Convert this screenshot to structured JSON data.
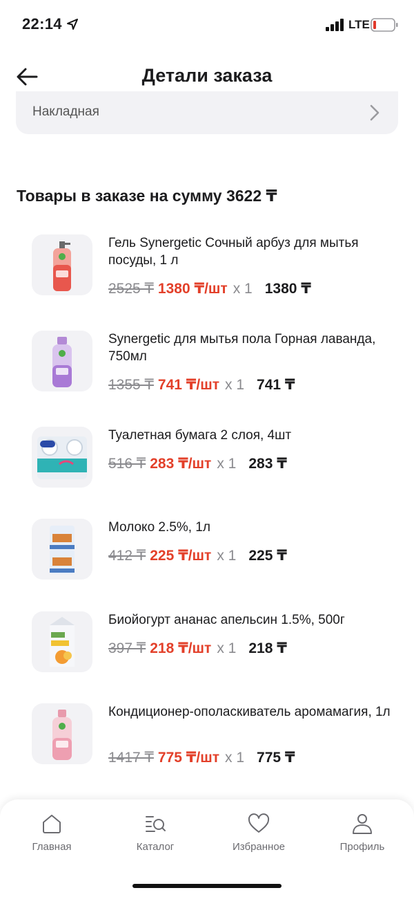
{
  "status_bar": {
    "time": "22:14",
    "network": "LTE"
  },
  "header": {
    "title": "Детали заказа"
  },
  "invoice": {
    "label": "Накладная"
  },
  "section": {
    "title": "Товары в заказе на сумму 3622 ₸"
  },
  "products": [
    {
      "name": "Гель Synergetic Сочный арбуз для мытья посуды, 1 л",
      "old_price": "2525 ₸",
      "unit_price": "1380 ₸/шт",
      "qty": "x 1",
      "total": "1380 ₸"
    },
    {
      "name": "Synergetic для мытья пола Горная лаванда, 750мл",
      "old_price": "1355 ₸",
      "unit_price": "741 ₸/шт",
      "qty": "x 1",
      "total": "741 ₸"
    },
    {
      "name": "Туалетная бумага 2 слоя, 4шт",
      "old_price": "516 ₸",
      "unit_price": "283 ₸/шт",
      "qty": "x 1",
      "total": "283 ₸"
    },
    {
      "name": "Молоко 2.5%, 1л",
      "old_price": "412 ₸",
      "unit_price": "225 ₸/шт",
      "qty": "x 1",
      "total": "225 ₸"
    },
    {
      "name": "Биойогурт ананас апельсин 1.5%, 500г",
      "old_price": "397 ₸",
      "unit_price": "218 ₸/шт",
      "qty": "x 1",
      "total": "218 ₸"
    },
    {
      "name": "Кондиционер-ополаскиватель аромамагия, 1л",
      "old_price": "1417 ₸",
      "unit_price": "775 ₸/шт",
      "qty": "x 1",
      "total": "775 ₸"
    }
  ],
  "tab_bar": {
    "home": "Главная",
    "catalog": "Каталог",
    "favorites": "Избранное",
    "profile": "Профиль"
  },
  "colors": {
    "accent_red": "#e3402a",
    "muted_gray": "#8a8a8e",
    "card_bg": "#f2f2f5"
  }
}
